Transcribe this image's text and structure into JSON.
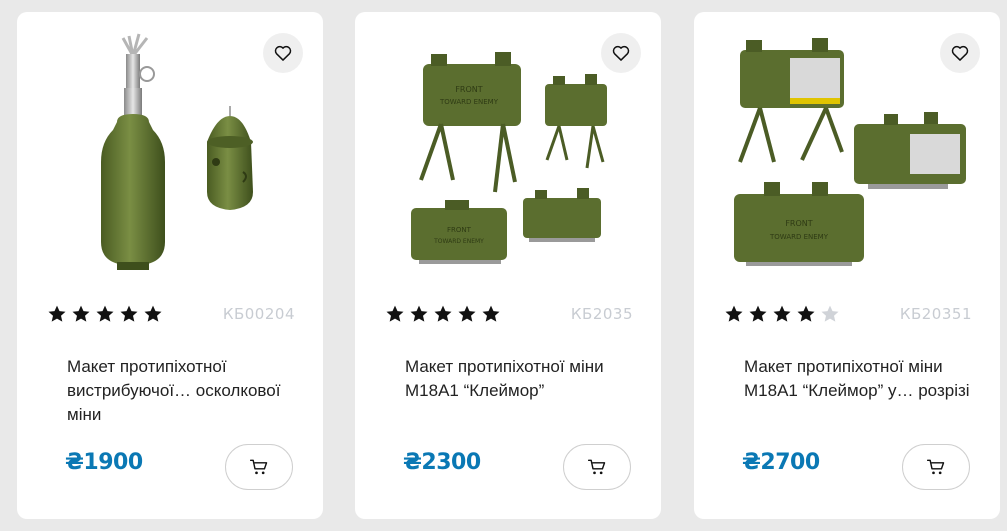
{
  "products": [
    {
      "title": "Макет протипіхотної вистрибуючої… осколкової міни",
      "sku": "КБ00204",
      "price": "₴1900",
      "rating": 5,
      "image": "bounding-fragmentation-mine-model"
    },
    {
      "title": "Макет протипіхотної міни М18А1 “Клеймор”",
      "sku": "КБ2035",
      "price": "₴2300",
      "rating": 5,
      "image": "claymore-m18a1-mine-model"
    },
    {
      "title": "Макет протипіхотної міни М18А1 “Клеймор” у… розрізі",
      "sku": "КБ20351",
      "price": "₴2700",
      "rating": 4,
      "image": "claymore-m18a1-cutaway-model"
    }
  ],
  "image_labels": {
    "front_toward_enemy": [
      "FRONT",
      "TOWARD ENEMY"
    ]
  },
  "icons": {
    "favorite": "heart-icon",
    "cart": "cart-icon",
    "rating_filled": "star-filled-icon",
    "rating_empty": "star-empty-icon"
  },
  "colors": {
    "price": "#0a78b4",
    "star_filled": "#111111",
    "star_empty": "#d0d3d8",
    "mine_green": "#5b6e2f"
  }
}
